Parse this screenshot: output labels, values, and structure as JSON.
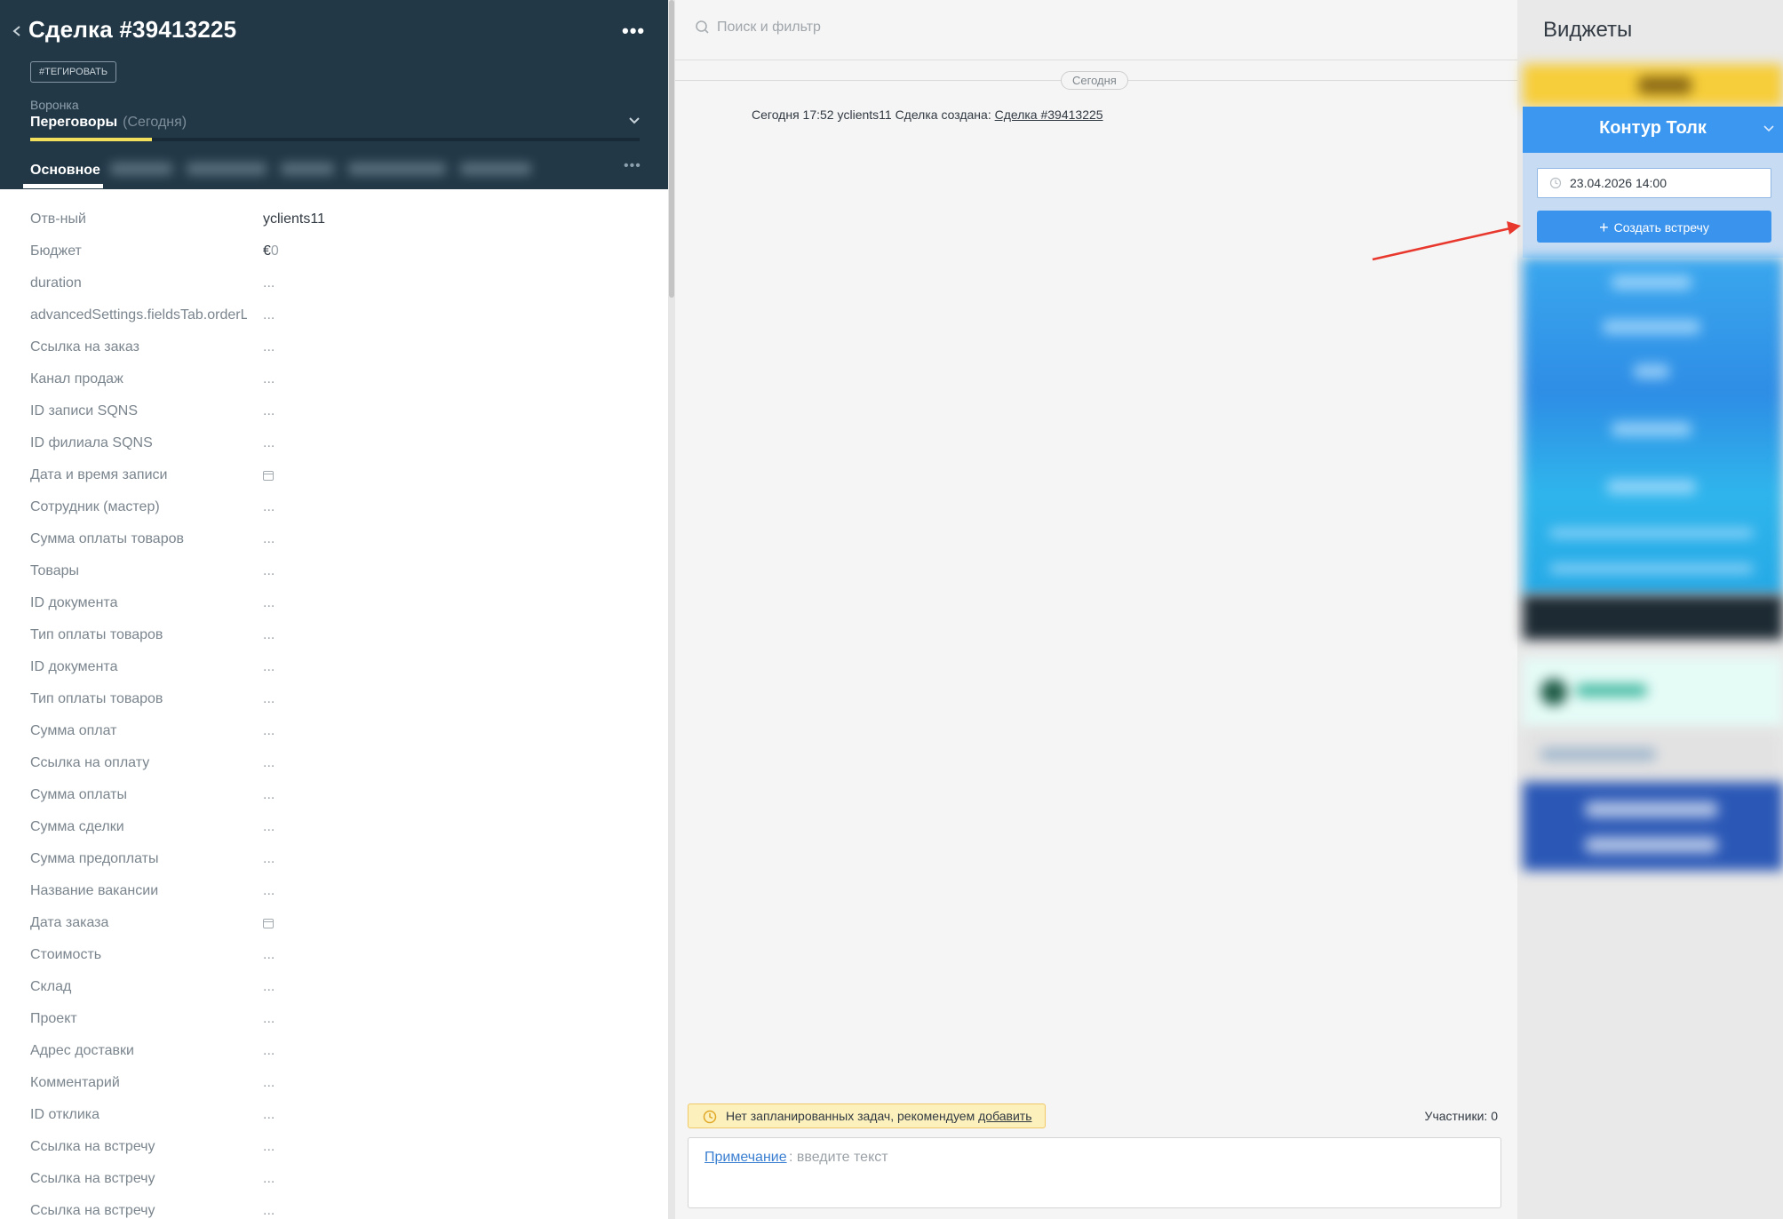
{
  "deal": {
    "title": "Сделка #39413225",
    "tag_button": "#ТЕГИРОВАТЬ",
    "funnel_label": "Воронка",
    "funnel_stage": "Переговоры",
    "funnel_stage_date": "(Сегодня)",
    "pipeline_progress": 0.2,
    "tab_main": "Основное"
  },
  "fields": [
    {
      "label": "Отв-ный",
      "value": "yclients11",
      "type": "text-strong"
    },
    {
      "label": "Бюджет",
      "value": "€0",
      "type": "budget"
    },
    {
      "label": "duration",
      "value": "...",
      "type": "text"
    },
    {
      "label": "advancedSettings.fieldsTab.orderL",
      "value": "...",
      "type": "text"
    },
    {
      "label": "Ссылка на заказ",
      "value": "...",
      "type": "text"
    },
    {
      "label": "Канал продаж",
      "value": "...",
      "type": "text"
    },
    {
      "label": "ID записи SQNS",
      "value": "...",
      "type": "text"
    },
    {
      "label": "ID филиала SQNS",
      "value": "...",
      "type": "text"
    },
    {
      "label": "Дата и время записи",
      "value": "",
      "type": "calendar"
    },
    {
      "label": "Сотрудник (мастер)",
      "value": "...",
      "type": "text"
    },
    {
      "label": "Сумма оплаты товаров",
      "value": "...",
      "type": "text"
    },
    {
      "label": "Товары",
      "value": "...",
      "type": "text"
    },
    {
      "label": "ID документа",
      "value": "...",
      "type": "text"
    },
    {
      "label": "Тип оплаты товаров",
      "value": "...",
      "type": "text"
    },
    {
      "label": "ID документа",
      "value": "...",
      "type": "text"
    },
    {
      "label": "Тип оплаты товаров",
      "value": "...",
      "type": "text"
    },
    {
      "label": "Сумма оплат",
      "value": "...",
      "type": "text"
    },
    {
      "label": "Ссылка на оплату",
      "value": "...",
      "type": "text"
    },
    {
      "label": "Сумма оплаты",
      "value": "...",
      "type": "text"
    },
    {
      "label": "Сумма сделки",
      "value": "...",
      "type": "text"
    },
    {
      "label": "Сумма предоплаты",
      "value": "...",
      "type": "text"
    },
    {
      "label": "Название вакансии",
      "value": "...",
      "type": "text"
    },
    {
      "label": "Дата заказа",
      "value": "",
      "type": "calendar"
    },
    {
      "label": "Стоимость",
      "value": "...",
      "type": "text"
    },
    {
      "label": "Склад",
      "value": "...",
      "type": "text"
    },
    {
      "label": "Проект",
      "value": "...",
      "type": "text"
    },
    {
      "label": "Адрес доставки",
      "value": "...",
      "type": "text"
    },
    {
      "label": "Комментарий",
      "value": "...",
      "type": "text"
    },
    {
      "label": "ID отклика",
      "value": "...",
      "type": "text"
    },
    {
      "label": "Ссылка на встречу",
      "value": "...",
      "type": "text"
    },
    {
      "label": "Ссылка на встречу",
      "value": "...",
      "type": "text"
    },
    {
      "label": "Ссылка на встречу",
      "value": "...",
      "type": "text"
    }
  ],
  "feed": {
    "search_placeholder": "Поиск и фильтр",
    "day_separator": "Сегодня",
    "event_text": "Сегодня 17:52 yclients11 Сделка создана: ",
    "event_link": "Сделка #39413225",
    "no_tasks_text": "Нет запланированных задач, рекомендуем ",
    "no_tasks_link": "добавить",
    "participants": "Участники: 0",
    "note_label": "Примечание",
    "note_placeholder": ": введите текст"
  },
  "widgets": {
    "title": "Виджеты",
    "kontur": {
      "title": "Контур Толк",
      "datetime": "23.04.2026 14:00",
      "create_button": "Создать встречу"
    }
  },
  "colors": {
    "header_bg": "#223847",
    "accent_blue": "#3a93ed",
    "pipeline_yellow": "#f2df5c",
    "annotation_arrow": "#e8372c"
  }
}
